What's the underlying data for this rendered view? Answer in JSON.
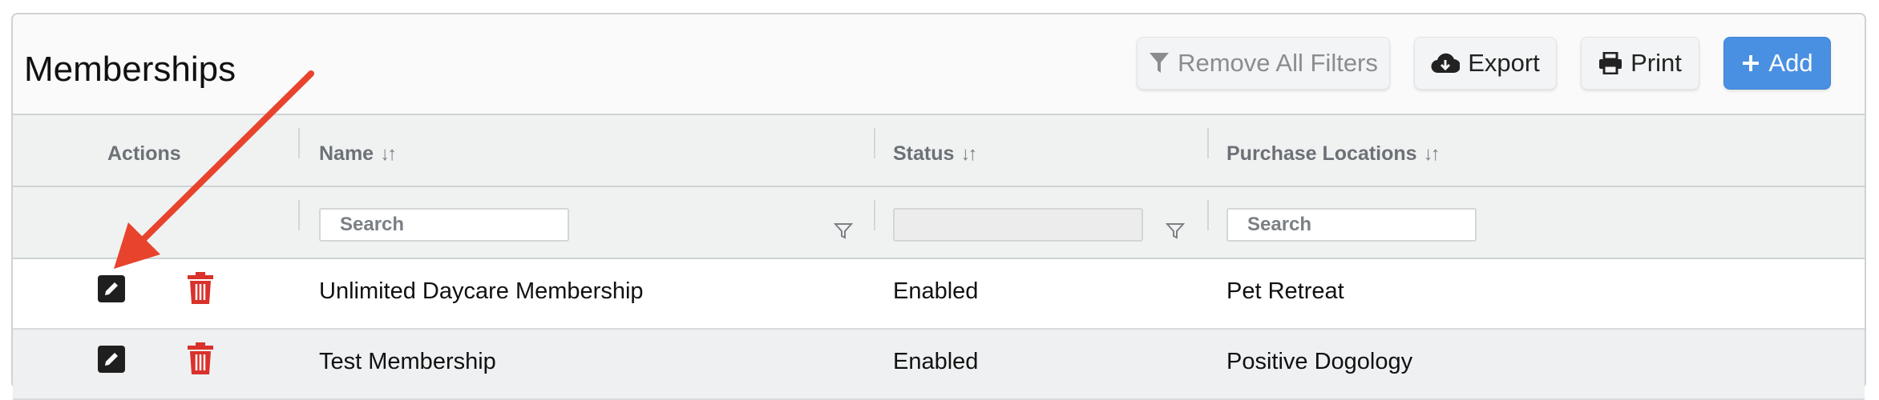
{
  "page": {
    "title": "Memberships"
  },
  "toolbar": {
    "remove_filters_label": "Remove All Filters",
    "export_label": "Export",
    "print_label": "Print",
    "add_label": "Add",
    "filter_icon": "funnel-icon",
    "export_icon": "cloud-download-icon",
    "print_icon": "printer-icon",
    "add_icon": "plus-icon"
  },
  "table": {
    "columns": [
      {
        "label": "Actions",
        "sortable": false
      },
      {
        "label": "Name",
        "sortable": true
      },
      {
        "label": "Status",
        "sortable": true
      },
      {
        "label": "Purchase Locations",
        "sortable": true
      }
    ],
    "filters": {
      "name_placeholder": "Search",
      "status_value": "",
      "locations_placeholder": "Search"
    },
    "rows": [
      {
        "name": "Unlimited Daycare Membership",
        "status": "Enabled",
        "locations": "Pet Retreat"
      },
      {
        "name": "Test Membership",
        "status": "Enabled",
        "locations": "Positive Dogology"
      }
    ]
  },
  "colors": {
    "accent": "#4a90e2",
    "delete": "#d9312b",
    "annotation_arrow": "#e8432d"
  }
}
